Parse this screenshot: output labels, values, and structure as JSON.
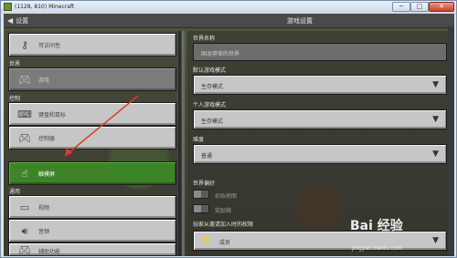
{
  "window": {
    "title": "(1128, 810) Minecraft",
    "min": "─",
    "max": "□",
    "close": "✕"
  },
  "header": {
    "back_label": "设置",
    "title": "游戏设置"
  },
  "left": {
    "top_item": {
      "label": "可访问性",
      "icon": "key-icon"
    },
    "section_world": "世界",
    "world_items": [
      {
        "label": "游戏",
        "icon": "gamepad-icon"
      }
    ],
    "section_controls": "控制",
    "control_items": [
      {
        "label": "键盘和鼠标",
        "icon": "keyboard-icon"
      },
      {
        "label": "控制器",
        "icon": "controller-icon"
      },
      {
        "label": "触摸屏",
        "icon": "touch-icon"
      }
    ],
    "section_general": "通用",
    "general_items": [
      {
        "label": "视频",
        "icon": "monitor-icon"
      },
      {
        "label": "音频",
        "icon": "speaker-icon"
      },
      {
        "label": "辅助功能",
        "icon": "controller-icon"
      }
    ]
  },
  "right": {
    "world_name_label": "世界名称",
    "world_name_value": "国龙莽荤的世界",
    "default_mode_label": "默认游戏模式",
    "default_mode_value": "生存模式",
    "personal_mode_label": "个人游戏模式",
    "personal_mode_value": "生存模式",
    "difficulty_label": "难度",
    "difficulty_value": "普通",
    "world_prefs_label": "世界偏好",
    "starter_map_label": "初始地图",
    "bonus_chest_label": "奖励箱",
    "join_perm_label": "玩家从邀请加入时的权限",
    "join_perm_value": "成员"
  },
  "colors": {
    "active": "#3c8527",
    "button": "#c6c6c6",
    "panel": "#4a4a4a",
    "arrow": "#e03a2e"
  },
  "watermark": {
    "text": "Bai 经验",
    "url": "jingyan.baidu.com"
  }
}
